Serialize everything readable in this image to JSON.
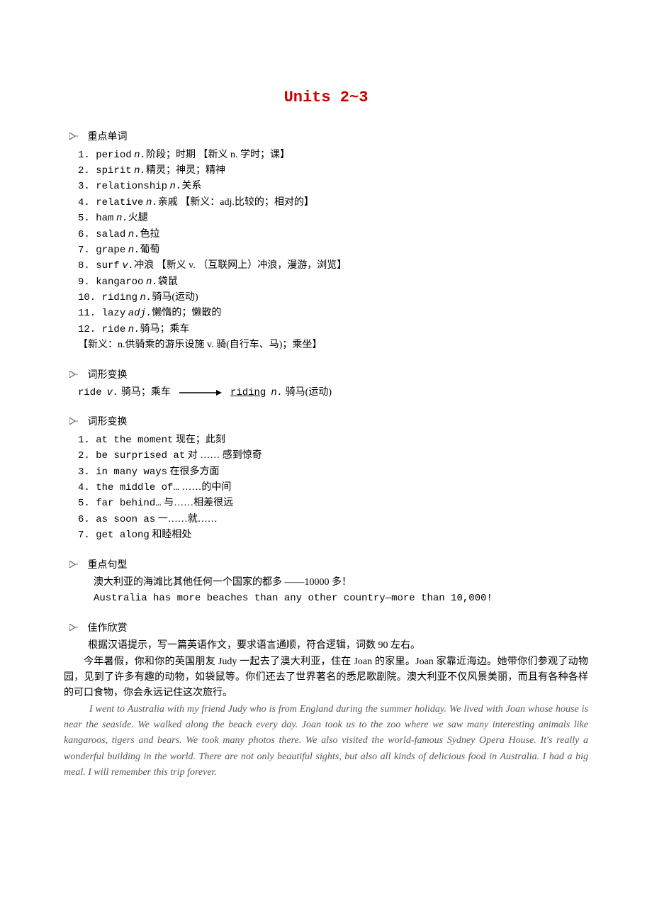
{
  "title": "Units 2~3",
  "sections": {
    "vocab": {
      "heading": "重点单词",
      "items": [
        {
          "num": "1.",
          "word": "period",
          "pos": "n.",
          "def": "阶段；时期",
          "note": "【新义  n. 学时；课】"
        },
        {
          "num": "2.",
          "word": "spirit",
          "pos": "n.",
          "def": "精灵；神灵；精神",
          "note": ""
        },
        {
          "num": "3.",
          "word": "relationship",
          "pos": "n.",
          "def": "关系",
          "note": ""
        },
        {
          "num": "4.",
          "word": "relative",
          "pos": "n.",
          "def": "亲戚",
          "note": "【新义：adj.比较的；相对的】"
        },
        {
          "num": "5.",
          "word": "ham",
          "pos": "n.",
          "def": "火腿",
          "note": ""
        },
        {
          "num": "6.",
          "word": "salad",
          "pos": "n.",
          "def": "色拉",
          "note": ""
        },
        {
          "num": "7.",
          "word": "grape",
          "pos": "n.",
          "def": "葡萄",
          "note": ""
        },
        {
          "num": "8.",
          "word": "surf",
          "pos": "v.",
          "def": "冲浪",
          "note": "【新义 v. （互联网上）冲浪，漫游，浏览】"
        },
        {
          "num": "9.",
          "word": "kangaroo",
          "pos": "n.",
          "def": "袋鼠",
          "note": ""
        },
        {
          "num": "10.",
          "word": "riding",
          "pos": "n.",
          "def": "骑马(运动)",
          "note": ""
        },
        {
          "num": "11.",
          "word": "lazy",
          "pos": "adj.",
          "def": "懒惰的；懒散的",
          "note": ""
        },
        {
          "num": "12.",
          "word": "ride",
          "pos": "n.",
          "def": "骑马；乘车",
          "note": ""
        }
      ],
      "footnote": "【新义：n.供骑乘的游乐设施 v. 骑(自行车、马)；乘坐】"
    },
    "conversion": {
      "heading": "词形变换",
      "from_word": "ride",
      "from_pos": "v.",
      "from_def": "骑马；乘车",
      "to_word": "riding",
      "to_pos": "n.",
      "to_def": "骑马(运动)"
    },
    "phrases": {
      "heading": "词形变换",
      "items": [
        {
          "num": "1.",
          "en": "at the moment",
          "cn": "现在；此刻"
        },
        {
          "num": "2.",
          "en": "be surprised at",
          "cn": "对 …… 感到惊奇"
        },
        {
          "num": "3.",
          "en": "in many ways",
          "cn": "在很多方面"
        },
        {
          "num": "4.",
          "en": "the middle of…",
          "cn": "……的中间"
        },
        {
          "num": "5.",
          "en": "far behind…",
          "cn": "与……相差很远"
        },
        {
          "num": "6.",
          "en": "as soon as",
          "cn": "一……就……"
        },
        {
          "num": "7.",
          "en": "get along",
          "cn": "和睦相处"
        }
      ]
    },
    "sentences": {
      "heading": "重点句型",
      "cn": "澳大利亚的海滩比其他任何一个国家的都多 ——10000 多！",
      "en": "Australia has more beaches than any other country—more than 10,000!"
    },
    "essay": {
      "heading": "佳作欣赏",
      "intro": "根据汉语提示，写一篇英语作文，要求语言通顺，符合逻辑，词数 90 左右。",
      "prompt": "今年暑假，你和你的英国朋友 Judy 一起去了澳大利亚，住在 Joan 的家里。Joan 家靠近海边。她带你们参观了动物园，见到了许多有趣的动物，如袋鼠等。你们还去了世界著名的悉尼歌剧院。澳大利亚不仅风景美丽，而且有各种各样的可口食物，你会永远记住这次旅行。",
      "body": [
        "I went to Australia with my friend Judy who is from England during the summer holiday. We lived with Joan whose house is near the seaside. We walked along the beach every day. Joan took us to the zoo where we saw many interesting animals like kangaroos, tigers and bears. We took many photos there. We also visited the world-famous Sydney Opera House. It's really a wonderful building in the world. There are not only beautiful sights, but also all kinds of delicious food in Australia. I had a big meal. I will remember this trip forever."
      ]
    }
  }
}
